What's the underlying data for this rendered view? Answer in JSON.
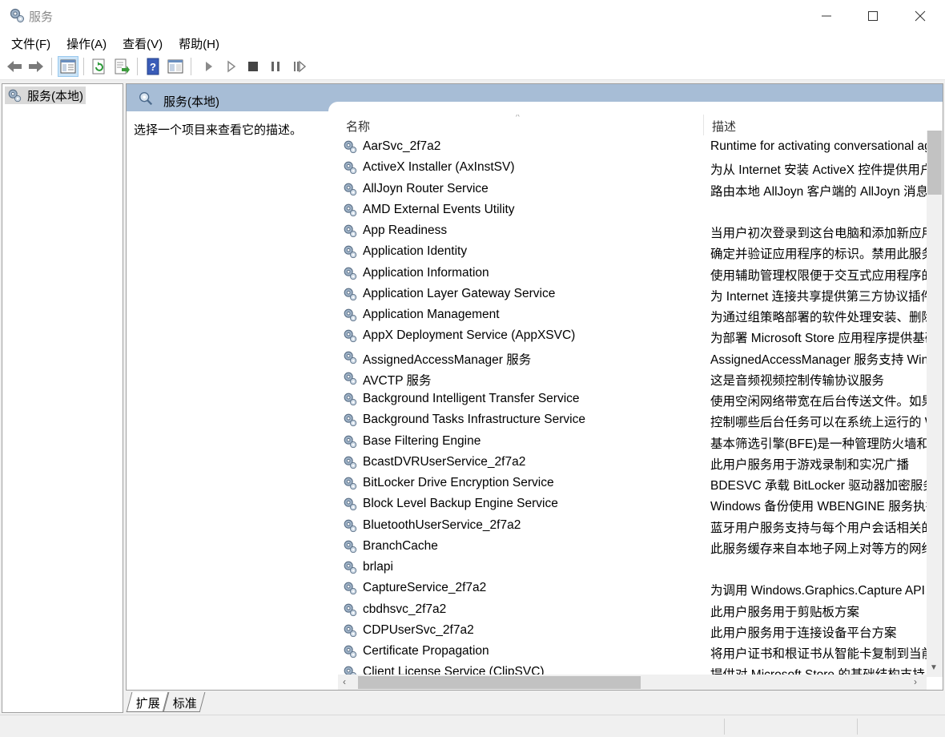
{
  "window": {
    "title": "服务"
  },
  "menu": [
    "文件(F)",
    "操作(A)",
    "查看(V)",
    "帮助(H)"
  ],
  "toolbar": {
    "icons": [
      "back-arrow-icon",
      "forward-arrow-icon",
      "show-hide-tree-icon",
      "refresh-icon",
      "export-list-icon",
      "help-icon",
      "properties-view-icon",
      "start-service-icon",
      "start-service-alt-icon",
      "stop-service-icon",
      "pause-service-icon",
      "resume-service-icon"
    ]
  },
  "tree": {
    "root_label": "服务(本地)"
  },
  "pane": {
    "header_title": "服务(本地)",
    "description_prompt": "选择一个项目来查看它的描述。"
  },
  "columns": {
    "name": "名称",
    "description": "描述"
  },
  "services": [
    {
      "name": "AarSvc_2f7a2",
      "desc": "Runtime for activating conversational ag"
    },
    {
      "name": "ActiveX Installer (AxInstSV)",
      "desc": "为从 Internet 安装 ActiveX 控件提供用户"
    },
    {
      "name": "AllJoyn Router Service",
      "desc": "路由本地 AllJoyn 客户端的 AllJoyn 消息。"
    },
    {
      "name": "AMD External Events Utility",
      "desc": ""
    },
    {
      "name": "App Readiness",
      "desc": "当用户初次登录到这台电脑和添加新应用"
    },
    {
      "name": "Application Identity",
      "desc": "确定并验证应用程序的标识。禁用此服务"
    },
    {
      "name": "Application Information",
      "desc": "使用辅助管理权限便于交互式应用程序的"
    },
    {
      "name": "Application Layer Gateway Service",
      "desc": "为 Internet 连接共享提供第三方协议插件"
    },
    {
      "name": "Application Management",
      "desc": "为通过组策略部署的软件处理安装、删除"
    },
    {
      "name": "AppX Deployment Service (AppXSVC)",
      "desc": "为部署 Microsoft Store 应用程序提供基础"
    },
    {
      "name": "AssignedAccessManager 服务",
      "desc": "AssignedAccessManager 服务支持 Windo"
    },
    {
      "name": "AVCTP 服务",
      "desc": "这是音频视频控制传输协议服务"
    },
    {
      "name": "Background Intelligent Transfer Service",
      "desc": "使用空闲网络带宽在后台传送文件。如果"
    },
    {
      "name": "Background Tasks Infrastructure Service",
      "desc": "控制哪些后台任务可以在系统上运行的 W"
    },
    {
      "name": "Base Filtering Engine",
      "desc": "基本筛选引擎(BFE)是一种管理防火墙和 In"
    },
    {
      "name": "BcastDVRUserService_2f7a2",
      "desc": "此用户服务用于游戏录制和实况广播"
    },
    {
      "name": "BitLocker Drive Encryption Service",
      "desc": "BDESVC 承载 BitLocker 驱动器加密服务。"
    },
    {
      "name": "Block Level Backup Engine Service",
      "desc": "Windows 备份使用 WBENGINE 服务执行"
    },
    {
      "name": "BluetoothUserService_2f7a2",
      "desc": "蓝牙用户服务支持与每个用户会话相关的"
    },
    {
      "name": "BranchCache",
      "desc": "此服务缓存来自本地子网上对等方的网络"
    },
    {
      "name": "brlapi",
      "desc": ""
    },
    {
      "name": "CaptureService_2f7a2",
      "desc": "为调用 Windows.Graphics.Capture API 的"
    },
    {
      "name": "cbdhsvc_2f7a2",
      "desc": "此用户服务用于剪贴板方案"
    },
    {
      "name": "CDPUserSvc_2f7a2",
      "desc": "此用户服务用于连接设备平台方案"
    },
    {
      "name": "Certificate Propagation",
      "desc": "将用户证书和根证书从智能卡复制到当前"
    },
    {
      "name": "Client License Service (ClipSVC)",
      "desc": "提供对 Microsoft Store 的基础结构支持"
    }
  ],
  "tabs": [
    "扩展",
    "标准"
  ],
  "colors": {
    "header_band": "#a7bdd6",
    "tree_selection": "#d9d9d9",
    "toolbar_active": "#cce4f7"
  }
}
